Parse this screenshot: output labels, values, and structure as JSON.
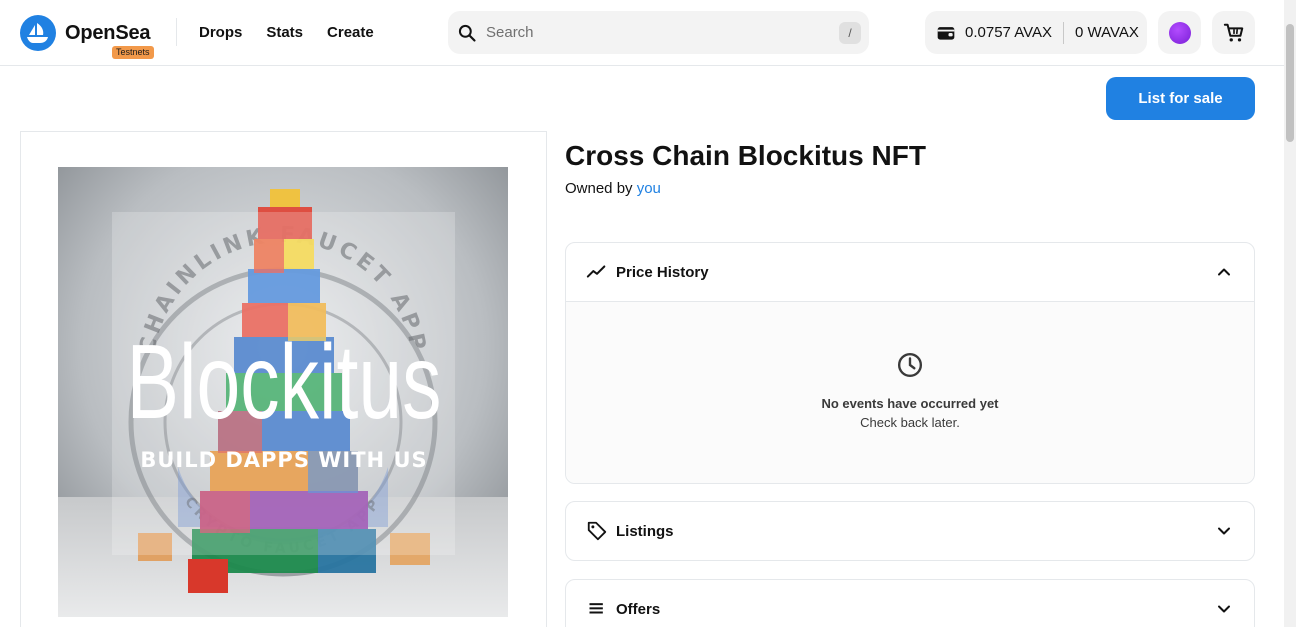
{
  "header": {
    "logo_text": "OpenSea",
    "testnet_badge": "Testnets",
    "nav": {
      "drops": "Drops",
      "stats": "Stats",
      "create": "Create"
    },
    "search": {
      "placeholder": "Search",
      "shortcut": "/"
    },
    "wallet": {
      "balance_primary": "0.0757 AVAX",
      "balance_wrapped": "0 WAVAX"
    }
  },
  "actions": {
    "list_for_sale": "List for sale"
  },
  "media": {
    "headline": "Blockitus",
    "tagline": "BUILD DAPPS WITH US",
    "ring_top_text": "CHAINLINK FAUCET APP",
    "ring_bottom_text": "CRYPTO FAUCET APP"
  },
  "item": {
    "title": "Cross Chain Blockitus NFT",
    "owned_by_label": "Owned by",
    "owner": "you"
  },
  "panels": {
    "price_history": {
      "title": "Price History",
      "empty_title": "No events have occurred yet",
      "empty_sub": "Check back later."
    },
    "listings": {
      "title": "Listings"
    },
    "offers": {
      "title": "Offers"
    }
  },
  "colors": {
    "accent": "#2081e2",
    "badge": "#f2994a",
    "avatar": "#8a2be2"
  }
}
